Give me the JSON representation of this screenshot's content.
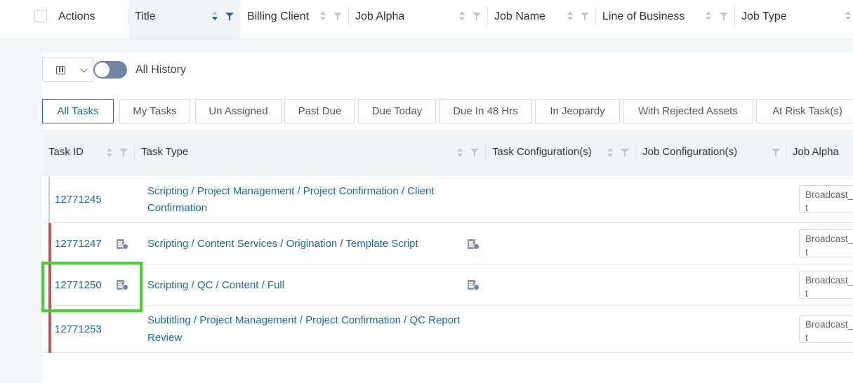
{
  "header": {
    "columns": [
      {
        "label": "Actions"
      },
      {
        "label": "Title"
      },
      {
        "label": "Billing Client"
      },
      {
        "label": "Job Alpha"
      },
      {
        "label": "Job Name"
      },
      {
        "label": "Line of Business"
      },
      {
        "label": "Job Type"
      }
    ]
  },
  "toolbar": {
    "history_toggle_label": "All History",
    "history_toggle_on": false
  },
  "tabs": [
    {
      "label": "All Tasks",
      "active": true
    },
    {
      "label": "My Tasks"
    },
    {
      "label": "Un Assigned"
    },
    {
      "label": "Past Due"
    },
    {
      "label": "Due Today"
    },
    {
      "label": "Due In 48 Hrs"
    },
    {
      "label": "In Jeopardy"
    },
    {
      "label": "With Rejected Assets"
    },
    {
      "label": "At Risk Task(s)"
    }
  ],
  "grid": {
    "columns": [
      {
        "label": "Task ID"
      },
      {
        "label": "Task Type"
      },
      {
        "label": "Task Configuration(s)"
      },
      {
        "label": "Job Configuration(s)"
      },
      {
        "label": "Job Alpha"
      }
    ],
    "rows": [
      {
        "task_id": "12771245",
        "task_type_line1": "Scripting / Project Management / Project Confirmation / Client",
        "task_type_line2": "Confirmation",
        "job_alpha": "Broadcast_\nt"
      },
      {
        "task_id": "12771247",
        "task_type_line1": "Scripting / Content Services / Origination / Template Script",
        "task_type_line2": "",
        "job_alpha": "Broadcast_\nt"
      },
      {
        "task_id": "12771250",
        "task_type_line1": "Scripting / QC / Content / Full",
        "task_type_line2": "",
        "job_alpha": "Broadcast_\nt"
      },
      {
        "task_id": "12771253",
        "task_type_line1": "Subtitling / Project Management / Project Confirmation / QC Report",
        "task_type_line2": "Review",
        "job_alpha": "Broadcast_\nt"
      }
    ]
  },
  "colors": {
    "link": "#1766a6",
    "accent": "#1766a6",
    "row_flag": "#c0575c",
    "highlight": "#3fd62a",
    "toggle": "#6f86a8"
  }
}
